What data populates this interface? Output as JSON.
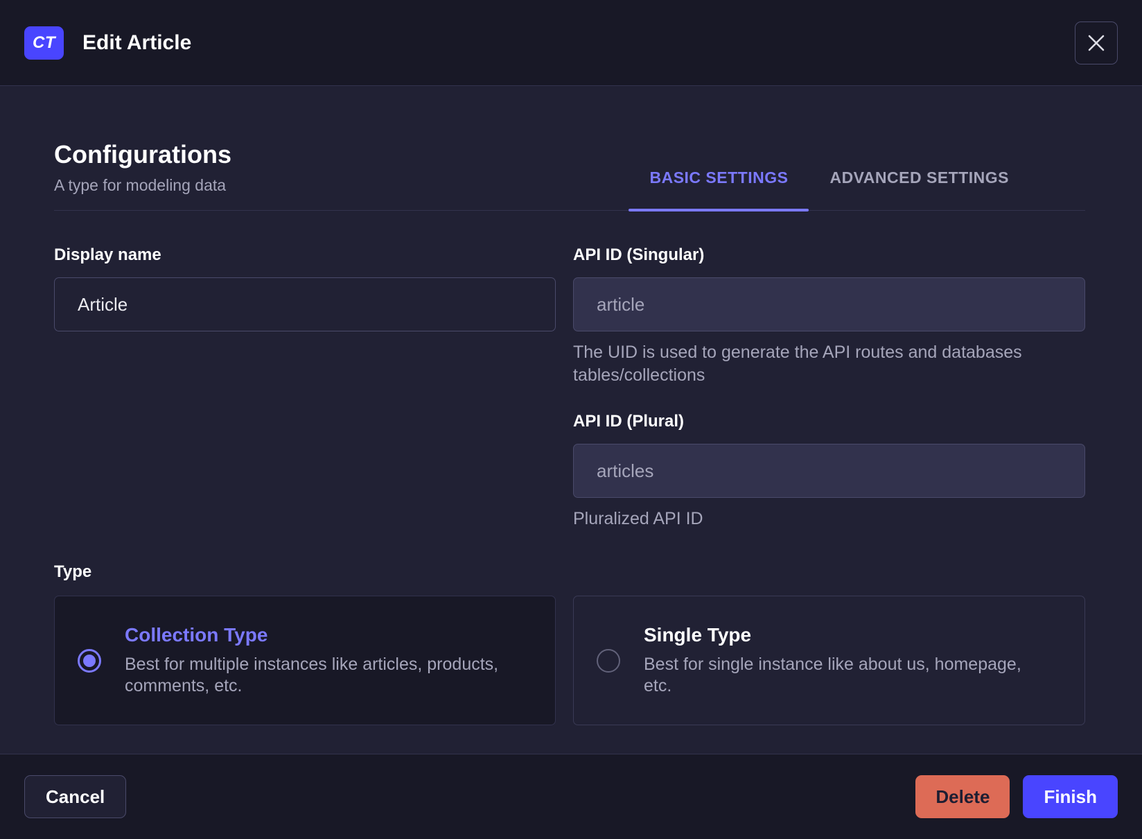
{
  "header": {
    "badge_label": "CT",
    "title": "Edit Article"
  },
  "config": {
    "title": "Configurations",
    "subtitle": "A type for modeling data",
    "tabs": [
      {
        "label": "BASIC SETTINGS",
        "active": true
      },
      {
        "label": "ADVANCED SETTINGS",
        "active": false
      }
    ]
  },
  "fields": {
    "display_name": {
      "label": "Display name",
      "value": "Article"
    },
    "api_id_singular": {
      "label": "API ID (Singular)",
      "placeholder": "article",
      "hint": "The UID is used to generate the API routes and databases tables/collections"
    },
    "api_id_plural": {
      "label": "API ID (Plural)",
      "placeholder": "articles",
      "hint": "Pluralized API ID"
    }
  },
  "type_section": {
    "label": "Type",
    "options": [
      {
        "title": "Collection Type",
        "description": "Best for multiple instances like articles, products, comments, etc.",
        "selected": true
      },
      {
        "title": "Single Type",
        "description": "Best for single instance like about us, homepage, etc.",
        "selected": false
      }
    ]
  },
  "footer": {
    "cancel_label": "Cancel",
    "delete_label": "Delete",
    "finish_label": "Finish"
  },
  "colors": {
    "primary": "#4945ff",
    "accent": "#7b79ff",
    "danger": "#dd6b56",
    "bg_chrome": "#181826",
    "bg_body": "#212134",
    "text_muted": "#a5a5ba"
  }
}
